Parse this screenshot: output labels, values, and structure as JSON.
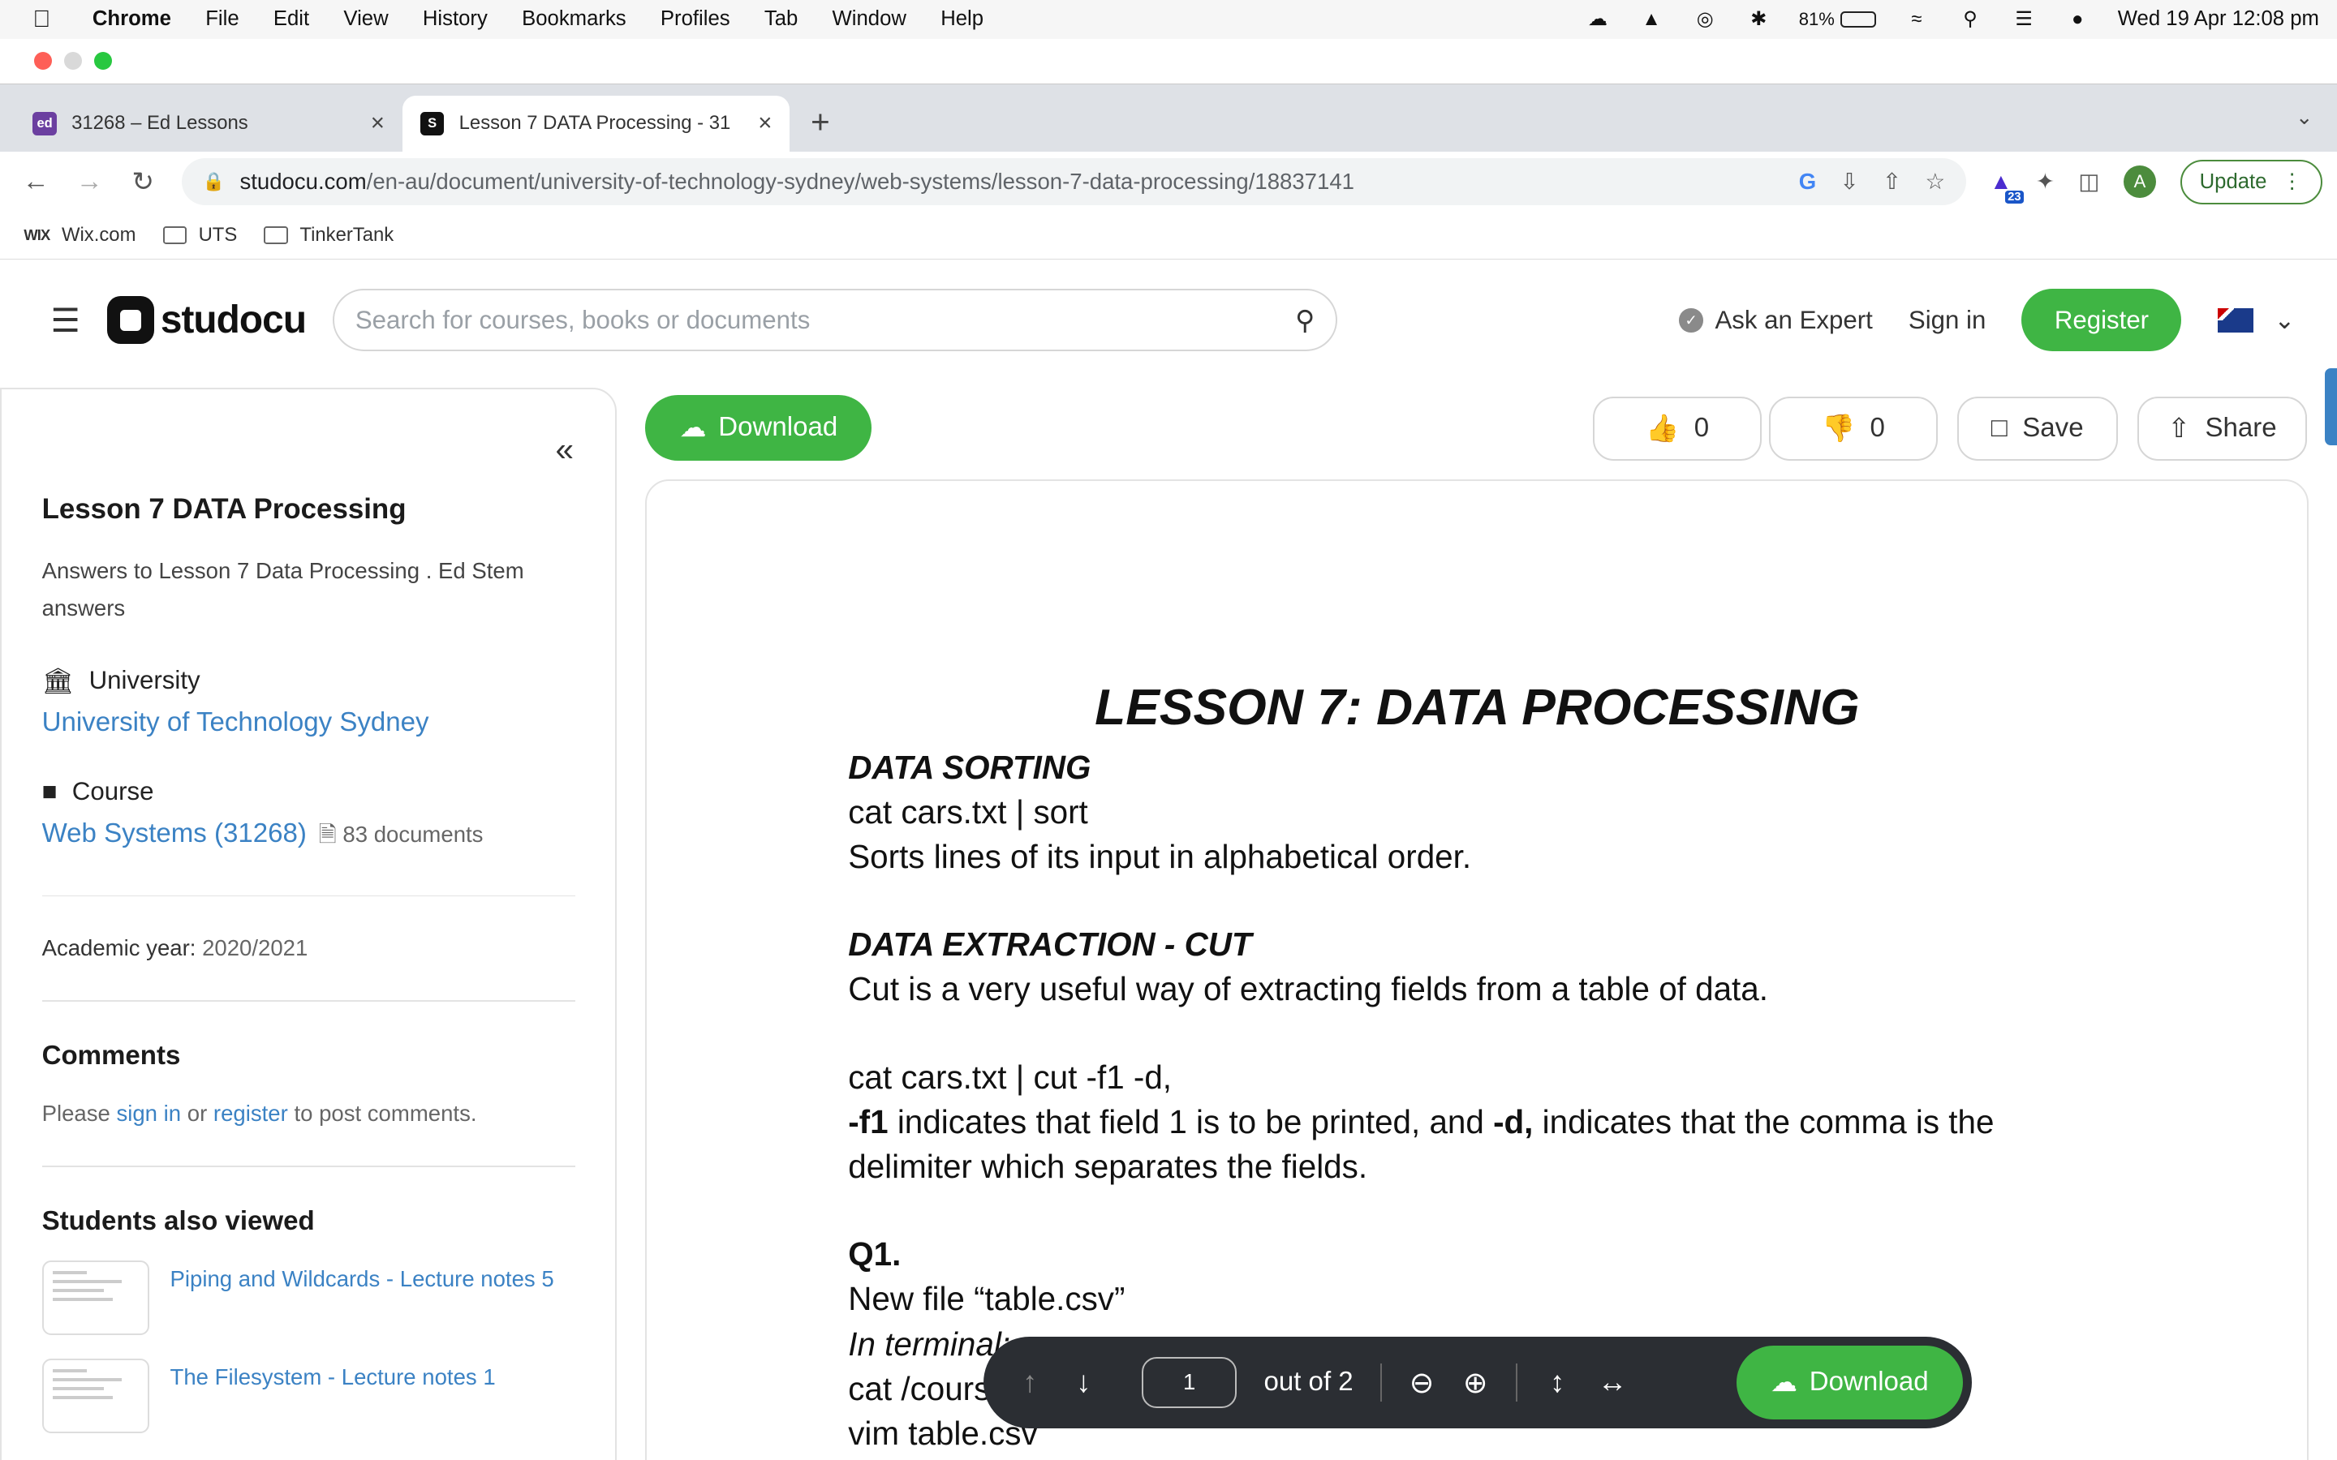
{
  "menubar": {
    "app": "Chrome",
    "items": [
      "File",
      "Edit",
      "View",
      "History",
      "Bookmarks",
      "Profiles",
      "Tab",
      "Window",
      "Help"
    ],
    "battery": "81%",
    "battery_level": 0.81,
    "datetime": "Wed 19 Apr  12:08 pm"
  },
  "tabs": [
    {
      "title": "31268 – Ed Lessons",
      "fav": "ed"
    },
    {
      "title": "Lesson 7 DATA Processing - 31"
    }
  ],
  "omnibox": {
    "domain": "studocu.com",
    "path": "/en-au/document/university-of-technology-sydney/web-systems/lesson-7-data-processing/18837141"
  },
  "profile": {
    "initial": "A",
    "update_label": "Update",
    "ext_badge": "23"
  },
  "bookmarks": [
    {
      "label": "Wix.com",
      "icon": "WIX"
    },
    {
      "label": "UTS"
    },
    {
      "label": "TinkerTank"
    }
  ],
  "header": {
    "logo": "studocu",
    "search_placeholder": "Search for courses, books or documents",
    "ask_expert": "Ask an Expert",
    "sign_in": "Sign in",
    "register": "Register"
  },
  "sidebar": {
    "title": "Lesson 7 DATA Processing",
    "description": "Answers to Lesson 7 Data Processing . Ed Stem answers",
    "university_label": "University",
    "university": "University of Technology Sydney",
    "course_label": "Course",
    "course": "Web Systems (31268)",
    "course_docs": "83 documents",
    "academic_label": "Academic year:",
    "academic_year": "2020/2021",
    "comments_title": "Comments",
    "comments_pre": "Please",
    "comments_signin": "sign in",
    "comments_or": "or",
    "comments_register": "register",
    "comments_post": "to post comments.",
    "also_title": "Students also viewed",
    "also": [
      "Piping and Wildcards - Lecture notes 5",
      "The Filesystem - Lecture notes 1"
    ]
  },
  "actions": {
    "download": "Download",
    "likes": "0",
    "dislikes": "0",
    "save": "Save",
    "share": "Share"
  },
  "document": {
    "title": "LESSON 7: DATA PROCESSING",
    "s1_head": "DATA SORTING",
    "s1_cmd": "cat cars.txt | sort",
    "s1_desc": "Sorts lines of its input in alphabetical order.",
    "s2_head": "DATA EXTRACTION - CUT",
    "s2_desc": "Cut is a very useful way of extracting fields from a table of data.",
    "s2_cmd": "cat cars.txt | cut -f1 -d,",
    "s2_f1": "-f1",
    "s2_mid": " indicates that field 1 is to be printed, and ",
    "s2_d": "-d,",
    "s2_end": " indicates that the comma is the",
    "s2_end2": "delimiter which separates the fields.",
    "q1": "Q1.",
    "q1_line1": "New file “table.csv”",
    "q1_line2": "In terminal:",
    "q1_line3": "cat /cours",
    "q1_line4": "vim table.csv"
  },
  "viewer": {
    "page": "1",
    "out_of": "out of 2",
    "download": "Download"
  }
}
